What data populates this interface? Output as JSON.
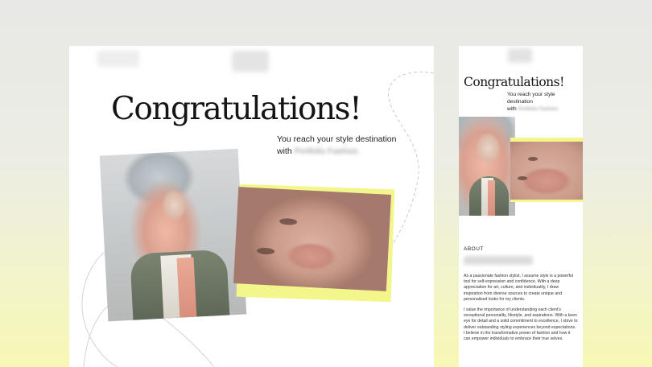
{
  "desktop": {
    "heading": "Congratulations!",
    "subtitle_line1": "You reach your style destination",
    "subtitle_prefix": "with",
    "subtitle_name": "Portfolio Fashion."
  },
  "mobile": {
    "heading": "Congratulations!",
    "subtitle_line1": "You reach your style destination",
    "subtitle_prefix": "with",
    "subtitle_name": "Portfolio Fashion.",
    "about_label": "ABOUT",
    "about_paragraph_1": "As a passionate fashion stylist, I assume style is a powerful tool for self-expression and confidence. With a deep appreciation for art, culture, and individuality, I draw inspiration from diverse sources to create unique and personalised looks for my clients.",
    "about_paragraph_2": "I value the importance of understanding each client's exceptional personality, lifestyle, and aspirations. With a keen eye for detail and a solid commitment to excellence, I strive to deliver outstanding styling experiences beyond expectations. I believe in the transformative power of fashion and how it can empower individuals to embrace their true selves."
  },
  "colors": {
    "accent_yellow": "#f3f68a",
    "background_bottom": "#f6f8b5",
    "text": "#141414"
  }
}
